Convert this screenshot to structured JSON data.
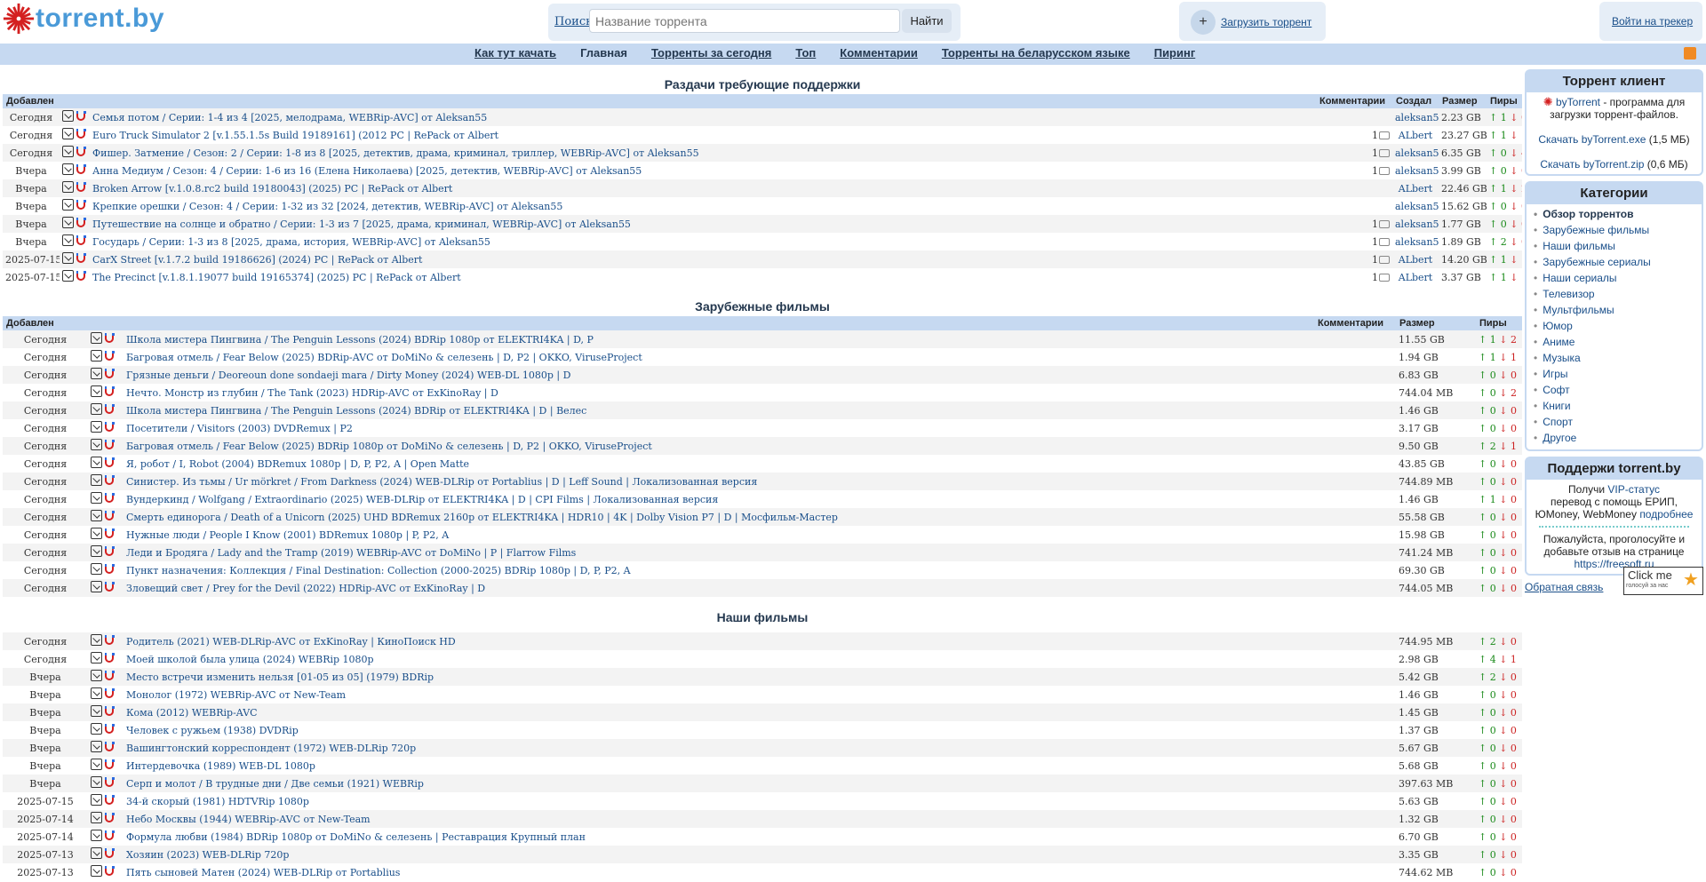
{
  "header": {
    "logo_text": "torrent.by",
    "search_label": "Поиск",
    "search_placeholder": "Название торрента",
    "search_button": "Найти",
    "upload_label": "Загрузить торрент",
    "upload_plus": "+",
    "login_label": "Войти на трекер"
  },
  "nav": [
    "Как тут качать",
    "Главная",
    "Торренты за сегодня",
    "Топ",
    "Комментарии",
    "Торренты на беларусском языке",
    "Пиринг"
  ],
  "support_section": {
    "title": "Раздачи требующие поддержки",
    "columns": {
      "added": "Добавлен",
      "comments": "Комментарии",
      "author": "Создал",
      "size": "Размер",
      "peers": "Пиры"
    },
    "rows": [
      {
        "date": "Сегодня",
        "title": "Семья потом / Серии: 1-4 из 4 [2025, мелодрама, WEBRip-AVC] от Aleksan55",
        "comments": "",
        "author": "aleksan55",
        "size": "2.23 GB",
        "up": "1",
        "down": "0"
      },
      {
        "date": "Сегодня",
        "title": "Euro Truck Simulator 2 [v.1.55.1.5s Build 19189161] (2012 PC | RePack от Albert",
        "comments": "1",
        "author": "ALbert",
        "size": "23.27 GB",
        "up": "1",
        "down": "1"
      },
      {
        "date": "Сегодня",
        "title": "Фишер. Затмение / Сезон: 2 / Серии: 1-8 из 8 [2025, детектив, драма, криминал, триллер, WEBRip-AVC] от Aleksan55",
        "comments": "1",
        "author": "aleksan55",
        "size": "6.35 GB",
        "up": "0",
        "down": "4"
      },
      {
        "date": "Вчера",
        "title": "Анна Медиум / Сезон: 4 / Серии: 1-6 из 16 (Елена Николаева) [2025, детектив, WEBRip-AVC] от Aleksan55",
        "comments": "1",
        "author": "aleksan55",
        "size": "3.99 GB",
        "up": "0",
        "down": "0"
      },
      {
        "date": "Вчера",
        "title": "Broken Arrow [v.1.0.8.rc2 build 19180043] (2025) PC | RePack от Albert",
        "comments": "",
        "author": "ALbert",
        "size": "22.46 GB",
        "up": "1",
        "down": "2"
      },
      {
        "date": "Вчера",
        "title": "Крепкие орешки / Сезон: 4 / Серии: 1-32 из 32 [2024, детектив, WEBRip-AVC] от Aleksan55",
        "comments": "",
        "author": "aleksan55",
        "size": "15.62 GB",
        "up": "0",
        "down": "0"
      },
      {
        "date": "Вчера",
        "title": "Путешествие на солнце и обратно / Серии: 1-3 из 7 [2025, драма, криминал, WEBRip-AVC] от Aleksan55",
        "comments": "1",
        "author": "aleksan55",
        "size": "1.77 GB",
        "up": "0",
        "down": "0"
      },
      {
        "date": "Вчера",
        "title": "Государь / Серии: 1-3 из 8 [2025, драма, история, WEBRip-AVC] от Aleksan55",
        "comments": "1",
        "author": "aleksan55",
        "size": "1.89 GB",
        "up": "2",
        "down": "0"
      },
      {
        "date": "2025-07-15",
        "title": "CarX Street [v.1.7.2 build 19186626] (2024) PC | RePack от Albert",
        "comments": "1",
        "author": "ALbert",
        "size": "14.20 GB",
        "up": "1",
        "down": "1"
      },
      {
        "date": "2025-07-15",
        "title": "The Precinct [v.1.8.1.19077 build 19165374] (2025) PC | RePack от Albert",
        "comments": "1",
        "author": "ALbert",
        "size": "3.37 GB",
        "up": "1",
        "down": "1"
      }
    ]
  },
  "foreign_section": {
    "title": "Зарубежные фильмы",
    "columns": {
      "added": "Добавлен",
      "comments": "Комментарии",
      "size": "Размер",
      "peers": "Пиры"
    },
    "rows": [
      {
        "date": "Сегодня",
        "title": "Школа мистера Пингвина / The Penguin Lessons (2024) BDRip 1080p от ELEKTRI4KA | D, P",
        "size": "11.55 GB",
        "up": "1",
        "down": "2"
      },
      {
        "date": "Сегодня",
        "title": "Багровая отмель / Fear Below (2025) BDRip-AVC от DoMiNo & селезень | D, P2 | OKKO, ViruseProject",
        "size": "1.94 GB",
        "up": "1",
        "down": "1"
      },
      {
        "date": "Сегодня",
        "title": "Грязные деньги / Deoreoun done sondaeji mara / Dirty Money (2024) WEB-DL 1080p | D",
        "size": "6.83 GB",
        "up": "0",
        "down": "0"
      },
      {
        "date": "Сегодня",
        "title": "Нечто. Монстр из глубин / The Tank (2023) HDRip-AVC от ExKinoRay | D",
        "size": "744.04 MB",
        "up": "0",
        "down": "2"
      },
      {
        "date": "Сегодня",
        "title": "Школа мистера Пингвина / The Penguin Lessons (2024) BDRip от ELEKTRI4KA | D | Велес",
        "size": "1.46 GB",
        "up": "0",
        "down": "0"
      },
      {
        "date": "Сегодня",
        "title": "Посетители / Visitors (2003) DVDRemux | P2",
        "size": "3.17 GB",
        "up": "0",
        "down": "0"
      },
      {
        "date": "Сегодня",
        "title": "Багровая отмель / Fear Below (2025) BDRip 1080p от DoMiNo & селезень | D, P2 | OKKO, ViruseProject",
        "size": "9.50 GB",
        "up": "2",
        "down": "1"
      },
      {
        "date": "Сегодня",
        "title": "Я, робот / I, Robot (2004) BDRemux 1080p | D, P, P2, A | Open Matte",
        "size": "43.85 GB",
        "up": "0",
        "down": "0"
      },
      {
        "date": "Сегодня",
        "title": "Синистер. Из тьмы / Ur mörkret / From Darkness (2024) WEB-DLRip от Portablius | D | Leff Sound | Локализованная версия",
        "size": "744.89 MB",
        "up": "0",
        "down": "0"
      },
      {
        "date": "Сегодня",
        "title": "Вундеркинд / Wolfgang / Extraordinario (2025) WEB-DLRip от ELEKTRI4KA | D | CPI Films | Локализованная версия",
        "size": "1.46 GB",
        "up": "1",
        "down": "0"
      },
      {
        "date": "Сегодня",
        "title": "Смерть единорога / Death of a Unicorn (2025) UHD BDRemux 2160p от ELEKTRI4KA | HDR10 | 4K | Dolby Vision P7 | D | Мосфильм-Мастер",
        "size": "55.58 GB",
        "up": "0",
        "down": "0"
      },
      {
        "date": "Сегодня",
        "title": "Нужные люди / People I Know (2001) BDRemux 1080p | P, P2, A",
        "size": "15.98 GB",
        "up": "0",
        "down": "0"
      },
      {
        "date": "Сегодня",
        "title": "Леди и Бродяга / Lady and the Tramp (2019) WEBRip-AVC от DoMiNo | P | Flarrow Films",
        "size": "741.24 MB",
        "up": "0",
        "down": "0"
      },
      {
        "date": "Сегодня",
        "title": "Пункт назначения: Коллекция / Final Destination: Collection (2000-2025) BDRip 1080p | D, P, P2, A",
        "size": "69.30 GB",
        "up": "0",
        "down": "0"
      },
      {
        "date": "Сегодня",
        "title": "Зловещий свет / Prey for the Devil (2022) HDRip-AVC от ExKinoRay | D",
        "size": "744.05 MB",
        "up": "0",
        "down": "0"
      }
    ]
  },
  "ours_section": {
    "title": "Наши фильмы",
    "rows": [
      {
        "date": "Сегодня",
        "title": "Родитель (2021) WEB-DLRip-AVC от ExKinoRay | КиноПоиск HD",
        "size": "744.95 MB",
        "up": "2",
        "down": "0"
      },
      {
        "date": "Сегодня",
        "title": "Моей школой была улица (2024) WEBRip 1080p",
        "size": "2.98 GB",
        "up": "4",
        "down": "1"
      },
      {
        "date": "Вчера",
        "title": "Место встречи изменить нельзя [01-05 из 05] (1979) BDRip",
        "size": "5.42 GB",
        "up": "2",
        "down": "0"
      },
      {
        "date": "Вчера",
        "title": "Монолог (1972) WEBRip-AVC от New-Team",
        "size": "1.46 GB",
        "up": "0",
        "down": "0"
      },
      {
        "date": "Вчера",
        "title": "Кома (2012) WEBRip-AVC",
        "size": "1.45 GB",
        "up": "0",
        "down": "0"
      },
      {
        "date": "Вчера",
        "title": "Человек с ружьем (1938) DVDRip",
        "size": "1.37 GB",
        "up": "0",
        "down": "0"
      },
      {
        "date": "Вчера",
        "title": "Вашингтонский корреспондент (1972) WEB-DLRip 720p",
        "size": "5.67 GB",
        "up": "0",
        "down": "0"
      },
      {
        "date": "Вчера",
        "title": "Интердевочка (1989) WEB-DL 1080p",
        "size": "5.68 GB",
        "up": "0",
        "down": "0"
      },
      {
        "date": "Вчера",
        "title": "Серп и молот / В трудные дни / Две семьи (1921) WEBRip",
        "size": "397.63 MB",
        "up": "0",
        "down": "0"
      },
      {
        "date": "2025-07-15",
        "title": "34-й скорый (1981) HDTVRip 1080p",
        "size": "5.63 GB",
        "up": "0",
        "down": "0"
      },
      {
        "date": "2025-07-14",
        "title": "Небо Москвы (1944) WEBRip-AVC от New-Team",
        "size": "1.32 GB",
        "up": "0",
        "down": "0"
      },
      {
        "date": "2025-07-14",
        "title": "Формула любви (1984) BDRip 1080p от DoMiNo & селезень | Реставрация Крупный план",
        "size": "6.70 GB",
        "up": "0",
        "down": "0"
      },
      {
        "date": "2025-07-13",
        "title": "Хозяин (2023) WEB-DLRip 720p",
        "size": "3.35 GB",
        "up": "0",
        "down": "0"
      },
      {
        "date": "2025-07-13",
        "title": "Пять сыновей Матен (2024) WEB-DLRip от Portablius",
        "size": "744.62 MB",
        "up": "0",
        "down": "0"
      }
    ]
  },
  "sidebar": {
    "client": {
      "title": "Торрент клиент",
      "link": "byTorrent",
      "desc": " - программа для загрузки торрент-файлов.",
      "exe_link": "Скачать byTorrent.exe",
      "exe_size": " (1,5 МБ)",
      "zip_link": "Скачать byTorrent.zip",
      "zip_size": " (0,6 МБ)"
    },
    "categories": {
      "title": "Категории",
      "items": [
        "Обзор торрентов",
        "Зарубежные фильмы",
        "Наши фильмы",
        "Зарубежные сериалы",
        "Наши сериалы",
        "Телевизор",
        "Мультфильмы",
        "Юмор",
        "Аниме",
        "Музыка",
        "Игры",
        "Софт",
        "Книги",
        "Спорт",
        "Другое"
      ]
    },
    "support": {
      "title": "Поддержи torrent.by",
      "text1": "Получи ",
      "vip": "VIP-статус",
      "text2": "перевод с помощь ЕРИП, ЮMoney, WebMoney ",
      "more": "подробнее",
      "text3": "Пожалуйста, проголосуйте и добавьте отзыв на странице ",
      "site": "https://freesoft.ru"
    },
    "feedback": "Обратная связь",
    "clickme_top": "Click me",
    "clickme_bottom": "голосуй за нас"
  }
}
